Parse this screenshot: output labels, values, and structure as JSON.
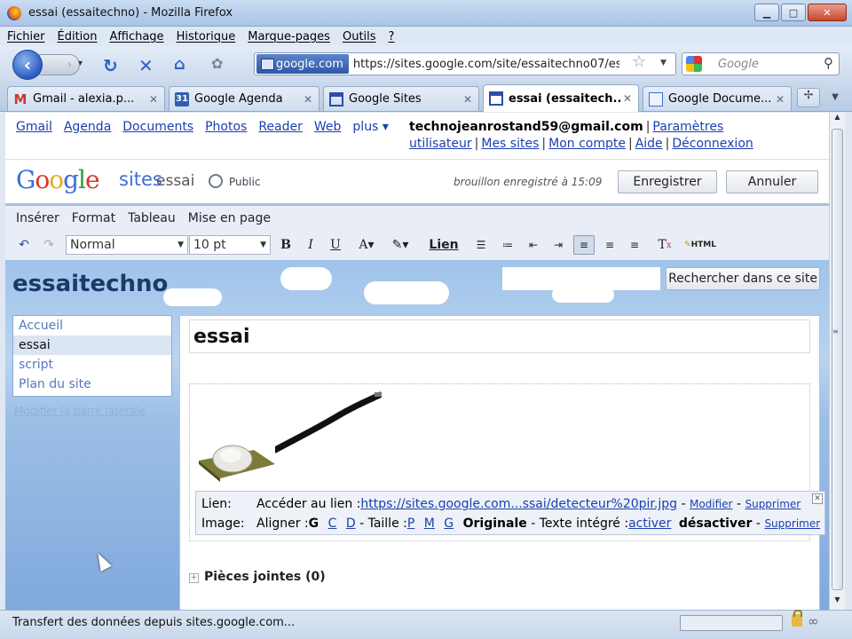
{
  "window": {
    "title": "essai (essaitechno) - Mozilla Firefox",
    "min": "▁",
    "max": "□",
    "close": "✕"
  },
  "menu": [
    "Fichier",
    "Édition",
    "Affichage",
    "Historique",
    "Marque-pages",
    "Outils",
    "?"
  ],
  "nav": {
    "site_identity": "google.com",
    "url": "https://sites.google.com/site/essaitechno07/essai",
    "search_placeholder": "Google"
  },
  "tabs": [
    {
      "label": "Gmail - alexia.p...",
      "favicon": "M",
      "color": "#c8372b"
    },
    {
      "label": "Google Agenda",
      "favicon": "31",
      "color": "#2f5fb3"
    },
    {
      "label": "Google Sites",
      "favicon": "",
      "color": "#2a4ea8"
    },
    {
      "label": "essai (essaitech...",
      "favicon": "",
      "color": "#2a4ea8"
    },
    {
      "label": "Google Docume...",
      "favicon": "",
      "color": "#3b6fd8"
    }
  ],
  "gbar": {
    "links": [
      "Gmail",
      "Agenda",
      "Documents",
      "Photos",
      "Reader",
      "Web",
      "plus ▾"
    ],
    "email": "technojeanrostand59@gmail.com",
    "user_links": [
      "Paramètres utilisateur",
      "Mes sites",
      "Mon compte",
      "Aide",
      "Déconnexion"
    ]
  },
  "header": {
    "logo_sites": "sites",
    "site_name": "essai",
    "visibility": "Public",
    "draft_status": "brouillon enregistré à 15:09",
    "save_label": "Enregistrer",
    "cancel_label": "Annuler"
  },
  "editor": {
    "menu": [
      "Insérer",
      "Format",
      "Tableau",
      "Mise en page"
    ],
    "style_value": "Normal",
    "size_value": "10 pt",
    "link_label": "Lien",
    "html_label": "HTML"
  },
  "site": {
    "title": "essaitechno",
    "search_button": "Rechercher dans ce site",
    "sidebar": [
      "Accueil",
      "essai",
      "script",
      "Plan du site"
    ],
    "current_page_index": 1,
    "edit_sidebar": "Modifier la barre latérale",
    "page_title": "essai",
    "attachments": "Pièces jointes (0)"
  },
  "linkbar": {
    "link_label": "Lien:",
    "access_text": "Accéder au lien :",
    "link_url": "https://sites.google.com...ssai/detecteur%20pir.jpg",
    "dash": "-",
    "modify": "Modifier",
    "delete": "Supprimer",
    "image_label": "Image:",
    "align_text": "Aligner :",
    "align_options": [
      "G",
      "C",
      "D"
    ],
    "size_text": "- Taille :",
    "size_options": [
      "P",
      "M",
      "G"
    ],
    "original": "Originale",
    "wrap_text": "- Texte intégré :",
    "activate": "activer",
    "deactivate": "désactiver",
    "delete2": "Supprimer"
  },
  "status": {
    "text": "Transfert des données depuis sites.google.com..."
  }
}
